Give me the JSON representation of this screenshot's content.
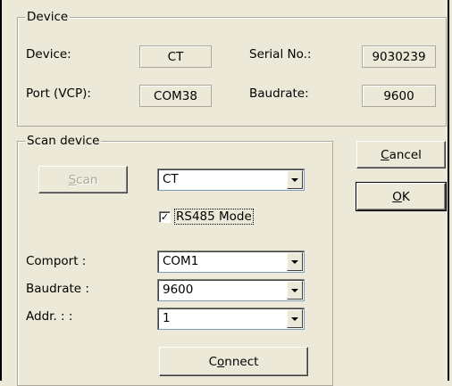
{
  "device_group": {
    "title": "Device",
    "device_label": "Device:",
    "device_value": "CT",
    "serial_label": "Serial No.:",
    "serial_value": "9030239",
    "port_label": "Port (VCP):",
    "port_value": "COM38",
    "baud_label": "Baudrate:",
    "baud_value": "9600"
  },
  "scan_group": {
    "title": "Scan device",
    "scan_button_prefix": "",
    "scan_button_mnemonic": "S",
    "scan_button_rest": "can",
    "device_select": "CT",
    "rs485_label": "RS485 Mode",
    "rs485_checked": true,
    "comport_label": "Comport :",
    "comport_value": "COM1",
    "baudrate_label": "Baudrate :",
    "baudrate_value": "9600",
    "addr_label": "Addr. : :",
    "addr_value": "1",
    "connect_prefix": "C",
    "connect_mnemonic": "o",
    "connect_rest": "nnect"
  },
  "actions": {
    "cancel_mnemonic": "C",
    "cancel_rest": "ancel",
    "ok_mnemonic": "O",
    "ok_rest": "K"
  }
}
